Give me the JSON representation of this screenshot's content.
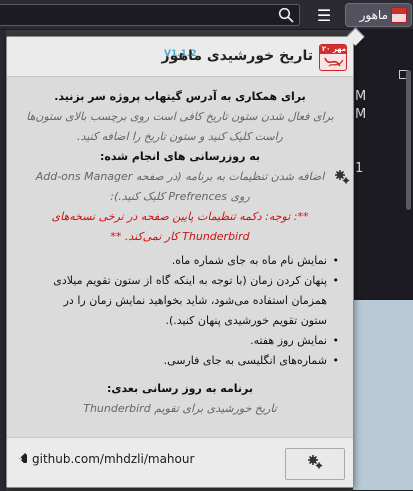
{
  "browser": {
    "extension_button_label": "ماهور",
    "menu_glyph": "☰",
    "background_glyphs": [
      "M",
      "M",
      "1"
    ]
  },
  "popup": {
    "title": "تاریخ خورشیدی ماهور",
    "version": "V1.1.2",
    "logo_text": "مهر ۲۰",
    "intro": {
      "heading": "برای همکاری به آدرس گیتهاب پروژه سر بزنید.",
      "line1": "برای فعال شدن ستون تاریخ کافی است روی برچسب بالای ستون‌ها",
      "line2": "راست کلیک کنید و ستون تاریخ را اضافه کنید."
    },
    "updates": {
      "heading": "به روزرسانی های انجام شده:",
      "settings_line1": "اضافه شدن تنظیمات به برنامه (در صفحه Add-ons Manager",
      "settings_line2": "روی Prefrences کلیک کنید.):",
      "warning_line1": "**: توجه: دکمه تنظیمات پایین صفحه در نرخی نسخه‌های",
      "warning_line2": "Thunderbird کار نمی‌کند. **",
      "items": [
        "نمایش نام ماه به جای شماره ماه.",
        "پنهان کردن زمان (با توجه به اینکه گاه از ستون تقویم میلادی",
        "همزمان استفاده می‌شود، شاید بخواهید نمایش زمان را در",
        "ستون تقویم خورشیدی پنهان کنید.).",
        "نمایش روز هفته.",
        "شماره‌های انگلیسی به جای فارسی."
      ]
    },
    "next": {
      "heading": "برنامه به روز رسانی بعدی:",
      "item": "تاریخ خورشیدی برای تقویم Thunderbird"
    },
    "footer": {
      "github_link": "github.com/mhdzli/mahour"
    }
  },
  "colors": {
    "accent_red": "#d32f2f",
    "warning_text": "#d01010",
    "version_color": "#44b0d0",
    "popup_bg": "#dbdbdb"
  },
  "icons": [
    "search-icon",
    "menu-icon",
    "gear-icon",
    "github-icon",
    "app-logo-icon"
  ]
}
